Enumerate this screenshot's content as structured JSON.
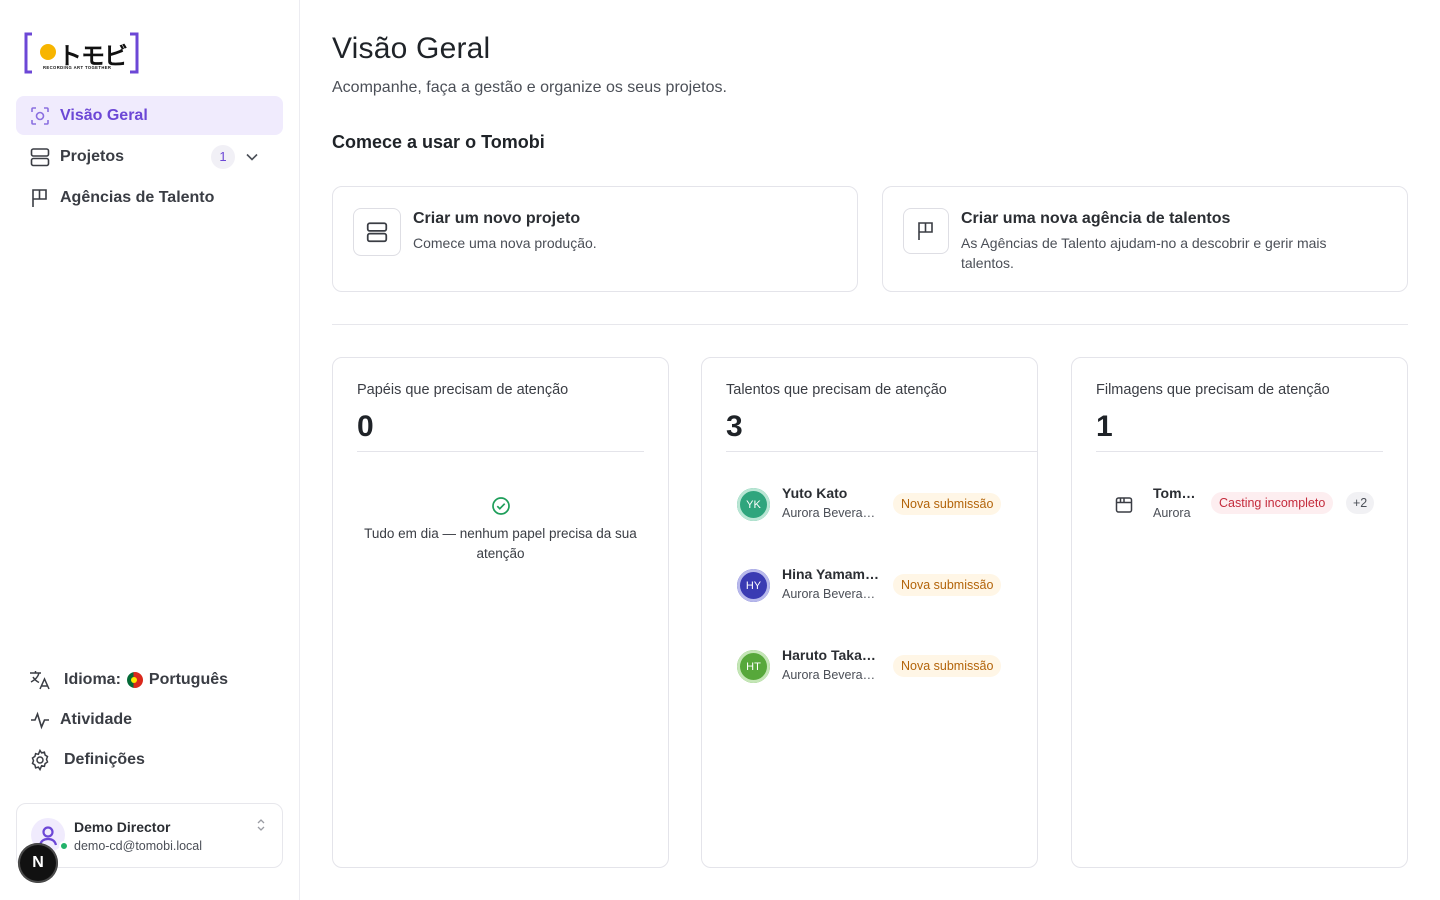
{
  "brand": {
    "logo_text": "トモビ",
    "tagline": "RECORDING ART TOGETHER",
    "accent": "#6c47d6",
    "logo_dot": "#f7b500"
  },
  "sidebar": {
    "items": [
      {
        "label": "Visão Geral",
        "icon": "overview-icon",
        "active": true
      },
      {
        "label": "Projetos",
        "icon": "projects-icon",
        "count": "1"
      },
      {
        "label": "Agências de Talento",
        "icon": "flag-icon"
      }
    ],
    "language": {
      "prefix": "Idioma:",
      "value": "Português"
    },
    "activity": "Atividade",
    "settings": "Definições",
    "user": {
      "name": "Demo Director",
      "email": "demo-cd@tomobi.local",
      "status_color": "#22b26a"
    },
    "dev_badge": "N"
  },
  "header": {
    "title": "Visão Geral",
    "subtitle": "Acompanhe, faça a gestão e organize os seus projetos."
  },
  "getting_started": {
    "title": "Comece a usar o Tomobi",
    "cards": [
      {
        "title": "Criar um novo projeto",
        "desc": "Comece uma nova produção."
      },
      {
        "title": "Criar uma nova agência de talentos",
        "desc": "As Agências de Talento ajudam-no a descobrir e gerir mais talentos."
      }
    ]
  },
  "stats": {
    "roles": {
      "label": "Papéis que precisam de atenção",
      "count": "0",
      "empty": "Tudo em dia — nenhum papel precisa da sua atenção"
    },
    "talents": {
      "label": "Talentos que precisam de atenção",
      "count": "3",
      "items": [
        {
          "initials": "YK",
          "name": "Yuto Kato",
          "sub": "Aurora Beverages",
          "badge": "Nova submissão",
          "color": "#2fa57d"
        },
        {
          "initials": "HY",
          "name": "Hina Yamamoto",
          "sub": "Aurora Beverages",
          "badge": "Nova submissão",
          "color": "#3a3bb3"
        },
        {
          "initials": "HT",
          "name": "Haruto Takahashi",
          "sub": "Aurora Beverages",
          "badge": "Nova submissão",
          "color": "#57a83b"
        }
      ]
    },
    "shoots": {
      "label": "Filmagens que precisam de atenção",
      "count": "1",
      "items": [
        {
          "name": "Tomobi",
          "sub": "Aurora",
          "badge": "Casting incompleto",
          "more": "+2"
        }
      ]
    }
  }
}
